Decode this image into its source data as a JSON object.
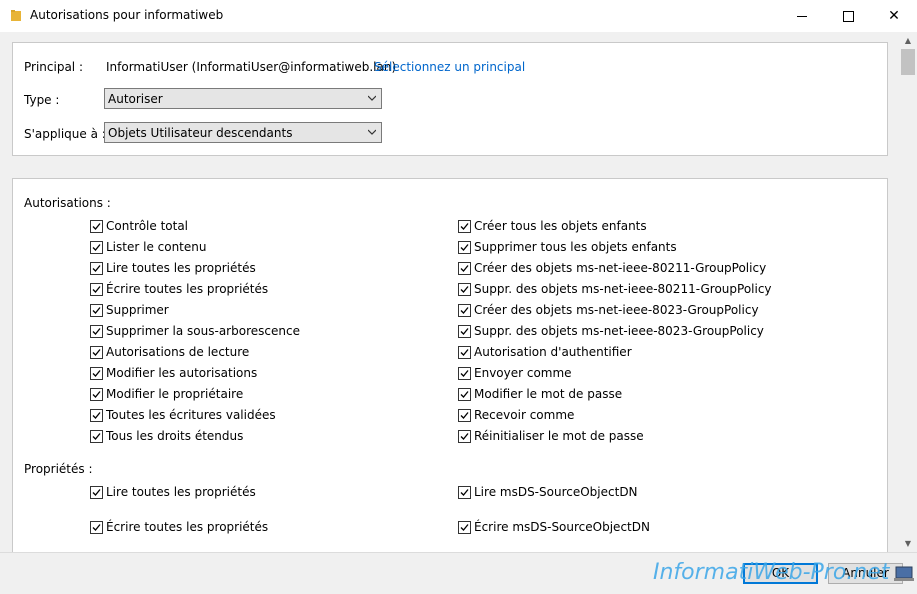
{
  "window": {
    "title": "Autorisations pour informatiweb",
    "minimize_glyph": "",
    "maximize_glyph": "",
    "close_glyph": "✕"
  },
  "principal": {
    "label": "Principal :",
    "value": "InformatiUser (InformatiUser@informatiweb.lan)",
    "link": "Sélectionnez un principal"
  },
  "type": {
    "label": "Type :",
    "value": "Autoriser"
  },
  "applies_to": {
    "label": "S'applique à :",
    "value": "Objets Utilisateur descendants"
  },
  "permissions": {
    "label": "Autorisations :",
    "left": [
      {
        "label": "Contrôle total",
        "checked": true
      },
      {
        "label": "Lister le contenu",
        "checked": true
      },
      {
        "label": "Lire toutes les propriétés",
        "checked": true
      },
      {
        "label": "Écrire toutes les propriétés",
        "checked": true
      },
      {
        "label": "Supprimer",
        "checked": true
      },
      {
        "label": "Supprimer la sous-arborescence",
        "checked": true
      },
      {
        "label": "Autorisations de lecture",
        "checked": true
      },
      {
        "label": "Modifier les autorisations",
        "checked": true
      },
      {
        "label": "Modifier le propriétaire",
        "checked": true
      },
      {
        "label": "Toutes les écritures validées",
        "checked": true
      },
      {
        "label": "Tous les droits étendus",
        "checked": true
      }
    ],
    "right": [
      {
        "label": "Créer tous les objets enfants",
        "checked": true
      },
      {
        "label": "Supprimer tous les objets enfants",
        "checked": true
      },
      {
        "label": "Créer des objets ms-net-ieee-80211-GroupPolicy",
        "checked": true
      },
      {
        "label": "Suppr. des objets ms-net-ieee-80211-GroupPolicy",
        "checked": true
      },
      {
        "label": "Créer des objets ms-net-ieee-8023-GroupPolicy",
        "checked": true
      },
      {
        "label": "Suppr. des objets ms-net-ieee-8023-GroupPolicy",
        "checked": true
      },
      {
        "label": "Autorisation d'authentifier",
        "checked": true
      },
      {
        "label": "Envoyer comme",
        "checked": true
      },
      {
        "label": "Modifier le mot de passe",
        "checked": true
      },
      {
        "label": "Recevoir comme",
        "checked": true
      },
      {
        "label": "Réinitialiser le mot de passe",
        "checked": true
      }
    ]
  },
  "properties": {
    "label": "Propriétés :",
    "left": [
      {
        "label": "Lire toutes les propriétés",
        "checked": true
      },
      {
        "label": "Écrire toutes les propriétés",
        "checked": true
      }
    ],
    "right": [
      {
        "label": "Lire msDS-SourceObjectDN",
        "checked": true
      },
      {
        "label": "Écrire msDS-SourceObjectDN",
        "checked": true
      }
    ]
  },
  "buttons": {
    "ok": "OK",
    "cancel": "Annuler"
  },
  "watermark": "InformatiWeb-Pro.net",
  "colors": {
    "link": "#0066cc",
    "watermark": "#3aa6e8",
    "accent": "#0078d7"
  }
}
